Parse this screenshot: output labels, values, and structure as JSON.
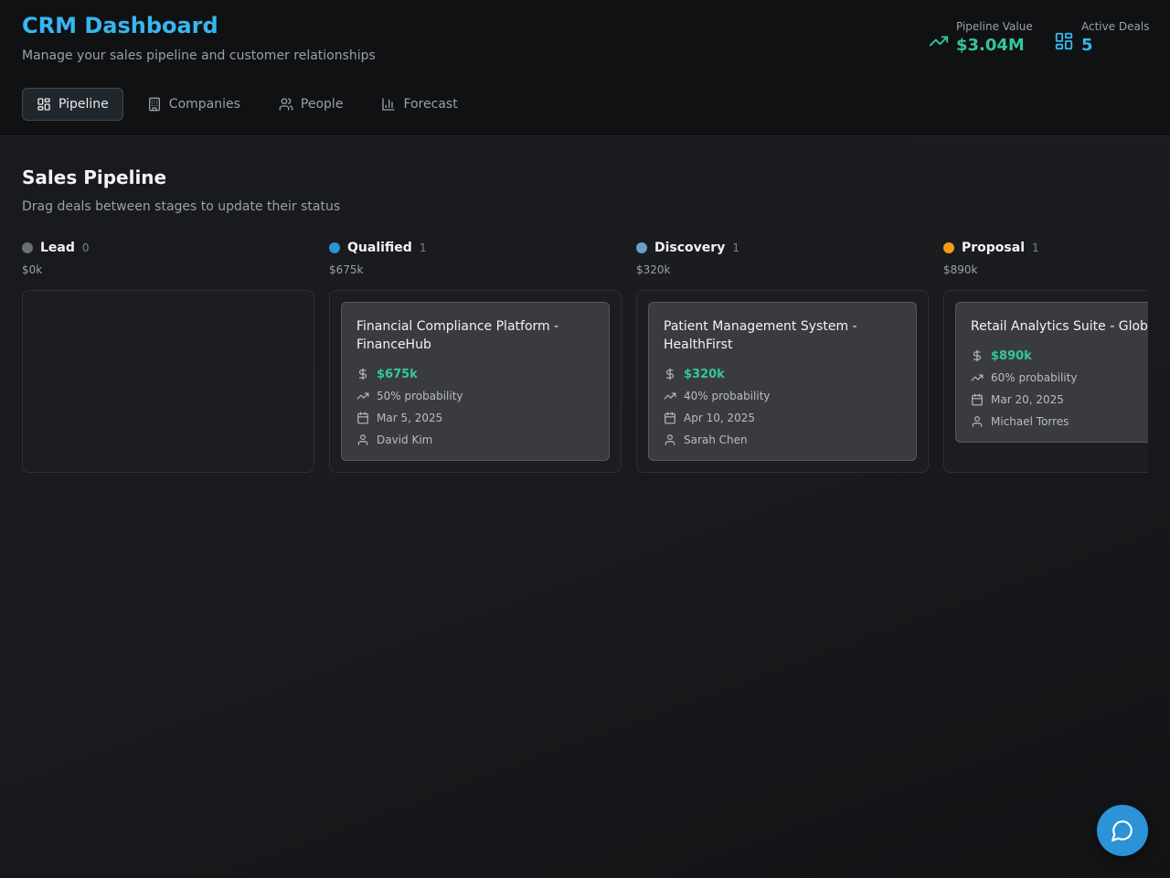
{
  "app": {
    "title": "CRM Dashboard",
    "subtitle": "Manage your sales pipeline and customer relationships"
  },
  "stats": {
    "pipeline_value": {
      "label": "Pipeline Value",
      "value": "$3.04M",
      "icon": "trending-up-icon",
      "color": "#34c79a"
    },
    "active_deals": {
      "label": "Active Deals",
      "value": "5",
      "icon": "layout-grid-icon",
      "color": "#38b6f0"
    }
  },
  "tabs": [
    {
      "label": "Pipeline",
      "icon": "layout-grid-icon",
      "active": true
    },
    {
      "label": "Companies",
      "icon": "building-icon",
      "active": false
    },
    {
      "label": "People",
      "icon": "users-icon",
      "active": false
    },
    {
      "label": "Forecast",
      "icon": "bar-chart-icon",
      "active": false
    }
  ],
  "pipeline": {
    "title": "Sales Pipeline",
    "subtitle": "Drag deals between stages to update their status",
    "columns": [
      {
        "name": "Lead",
        "count": "0",
        "total": "$0k",
        "color": "#6b6e73",
        "deals": []
      },
      {
        "name": "Qualified",
        "count": "1",
        "total": "$675k",
        "color": "#2b93d6",
        "deals": [
          {
            "title": "Financial Compliance Platform - FinanceHub",
            "amount": "$675k",
            "probability": "50% probability",
            "date": "Mar 5, 2025",
            "owner": "David Kim"
          }
        ]
      },
      {
        "name": "Discovery",
        "count": "1",
        "total": "$320k",
        "color": "#6a9ec9",
        "deals": [
          {
            "title": "Patient Management System - HealthFirst",
            "amount": "$320k",
            "probability": "40% probability",
            "date": "Apr 10, 2025",
            "owner": "Sarah Chen"
          }
        ]
      },
      {
        "name": "Proposal",
        "count": "1",
        "total": "$890k",
        "color": "#f39c12",
        "deals": [
          {
            "title": "Retail Analytics Suite - Glob",
            "amount": "$890k",
            "probability": "60% probability",
            "date": "Mar 20, 2025",
            "owner": "Michael Torres"
          }
        ]
      }
    ]
  },
  "chat": {
    "icon": "chat-bubble-icon",
    "color": "#2b93d6"
  }
}
